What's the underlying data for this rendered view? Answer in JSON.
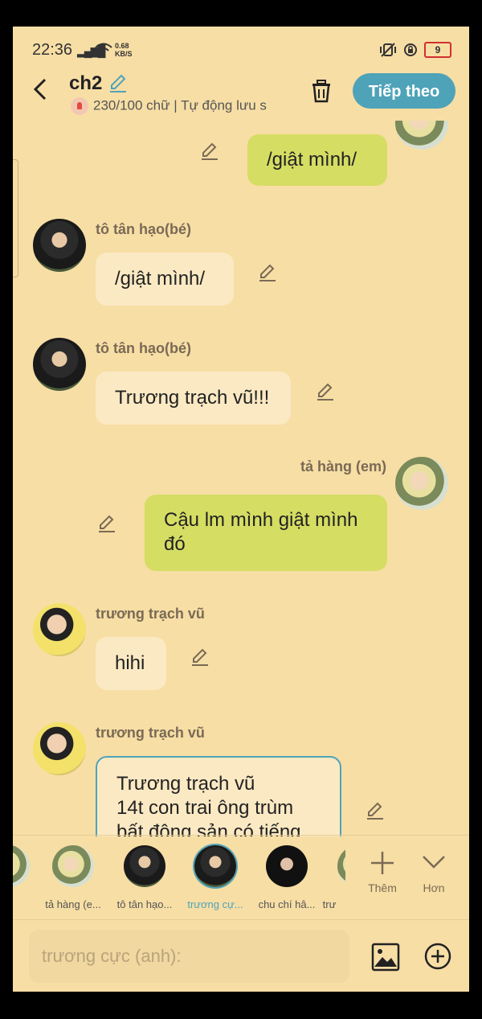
{
  "status": {
    "time": "22:36",
    "speed_value": "0.68",
    "speed_unit": "KB/S",
    "battery": "9"
  },
  "header": {
    "title": "ch2",
    "subtitle": "230/100 chữ | Tự động lưu s",
    "next_label": "Tiếp theo"
  },
  "messages": [
    {
      "side": "right",
      "name": "",
      "text": "/giật mình/"
    },
    {
      "side": "left",
      "name": "tô tân hạo(bé)",
      "text": "/giật mình/"
    },
    {
      "side": "left",
      "name": "tô tân hạo(bé)",
      "text": "Trương trạch vũ!!!"
    },
    {
      "side": "right",
      "name": "tả hàng (em)",
      "text_line1": "Cậu lm mình giật mình",
      "text_line2": "đó"
    },
    {
      "side": "left",
      "name": "trương trạch vũ",
      "text": "hihi"
    },
    {
      "side": "left",
      "name": "trương trạch vũ",
      "text_line1": "Trương trạch vũ",
      "text_line2": "14t con trai ông trùm",
      "text_line3": "bất động sản có tiếng"
    }
  ],
  "characters": [
    {
      "name": "tả hàng (e..."
    },
    {
      "name": "tô tân hạo..."
    },
    {
      "name": "trương cự..."
    },
    {
      "name": "chu chí hâ..."
    },
    {
      "name": "trư"
    }
  ],
  "tools": {
    "add_label": "Thêm",
    "more_label": "Hơn"
  },
  "input": {
    "placeholder": "trương cực (anh):"
  },
  "colors": {
    "accent": "#4fa3b8",
    "background": "#f7dea5",
    "bubble_left": "#fbe9c3",
    "bubble_right": "#d5dd63"
  }
}
